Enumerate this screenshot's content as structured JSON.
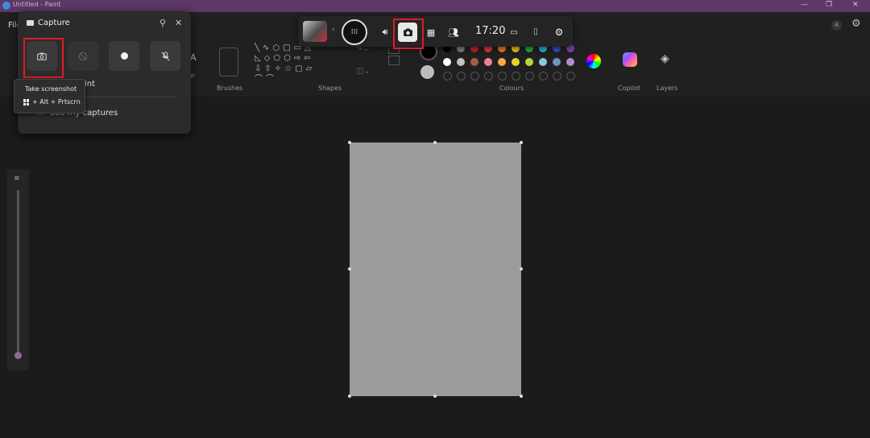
{
  "window": {
    "title": "Untitled - Paint"
  },
  "menu": {
    "file": "File"
  },
  "ribbon": {
    "brushes_label": "Brushes",
    "shapes_label": "Shapes",
    "colours_label": "Colours",
    "copilot_label": "Copilot",
    "layers_label": "Layers"
  },
  "gamebar": {
    "time": "17:20"
  },
  "capture": {
    "title": "Capture",
    "see_captures": "See my captures",
    "partial_text": "int"
  },
  "tooltip": {
    "title": "Take screenshot",
    "shortcut": "+ Alt + Prtscrn"
  },
  "colors": {
    "palette_row1": [
      "#000000",
      "#7f7f7f",
      "#c8222c",
      "#e53a32",
      "#f07d1d",
      "#f4c41b",
      "#28a745",
      "#22b0d8",
      "#3f48cc",
      "#7f3fa9"
    ],
    "palette_row2": [
      "#ffffff",
      "#c3c3c3",
      "#a35c45",
      "#e8868f",
      "#f7a94c",
      "#e6d12a",
      "#b6d33c",
      "#8fc5d9",
      "#7092be",
      "#b28fc8"
    ]
  }
}
